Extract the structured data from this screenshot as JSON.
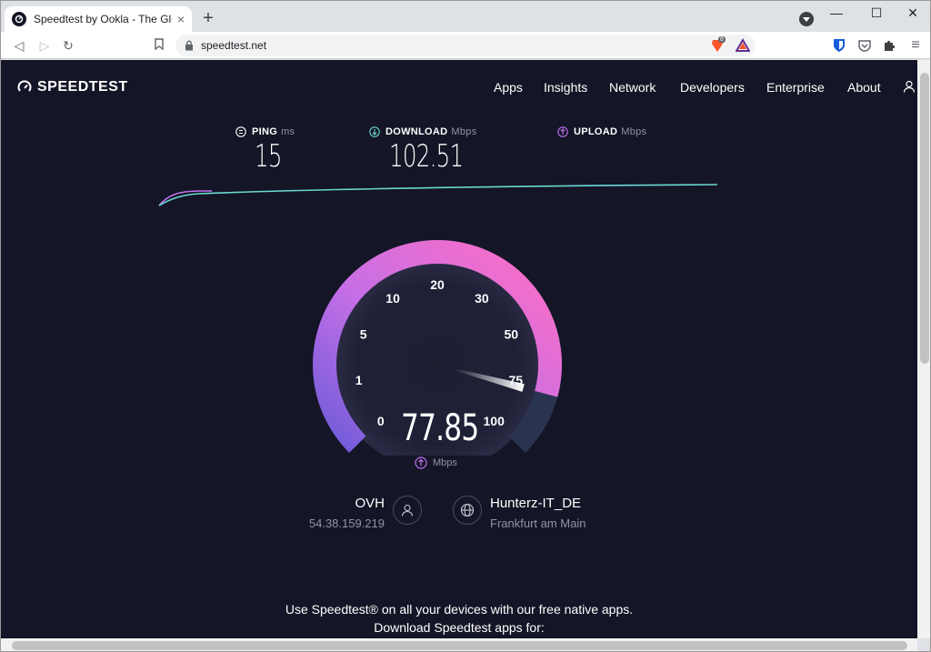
{
  "browser": {
    "tab_title": "Speedtest by Ookla - The Global Broadband Speed Test",
    "tab_close": "×",
    "new_tab": "+",
    "url": "speedtest.net",
    "window_minimize": "—",
    "window_maximize": "☐",
    "window_close": "✕",
    "back": "◁",
    "forward": "▷",
    "reload": "↻",
    "menu": "≡",
    "brave_shield_count": "8"
  },
  "site": {
    "logo": "SPEEDTEST",
    "nav": [
      "Apps",
      "Insights",
      "Network",
      "Developers",
      "Enterprise",
      "About"
    ]
  },
  "metrics": {
    "ping": {
      "label": "PING",
      "unit": "ms",
      "value": "15"
    },
    "download": {
      "label": "DOWNLOAD",
      "unit": "Mbps",
      "value": "102.51"
    },
    "upload": {
      "label": "UPLOAD",
      "unit": "Mbps",
      "value": ""
    }
  },
  "gauge": {
    "ticks": [
      "0",
      "1",
      "5",
      "10",
      "20",
      "30",
      "50",
      "75",
      "100"
    ],
    "reading": "77.85",
    "unit": "Mbps",
    "needle_value": 77.85,
    "color_start": "#6e5bd9",
    "color_end": "#ff6ec4",
    "track_color": "#2a3350"
  },
  "provider": {
    "isp": "OVH",
    "ip": "54.38.159.219",
    "server": "Hunterz-IT_DE",
    "location": "Frankfurt am Main"
  },
  "promo": {
    "line1": "Use Speedtest® on all your devices with our free native apps.",
    "line2": "Download Speedtest apps for:"
  },
  "icons": {
    "ping": "ping-icon",
    "download": "download-icon",
    "upload": "upload-icon",
    "user": "user-icon",
    "globe": "globe-icon"
  }
}
